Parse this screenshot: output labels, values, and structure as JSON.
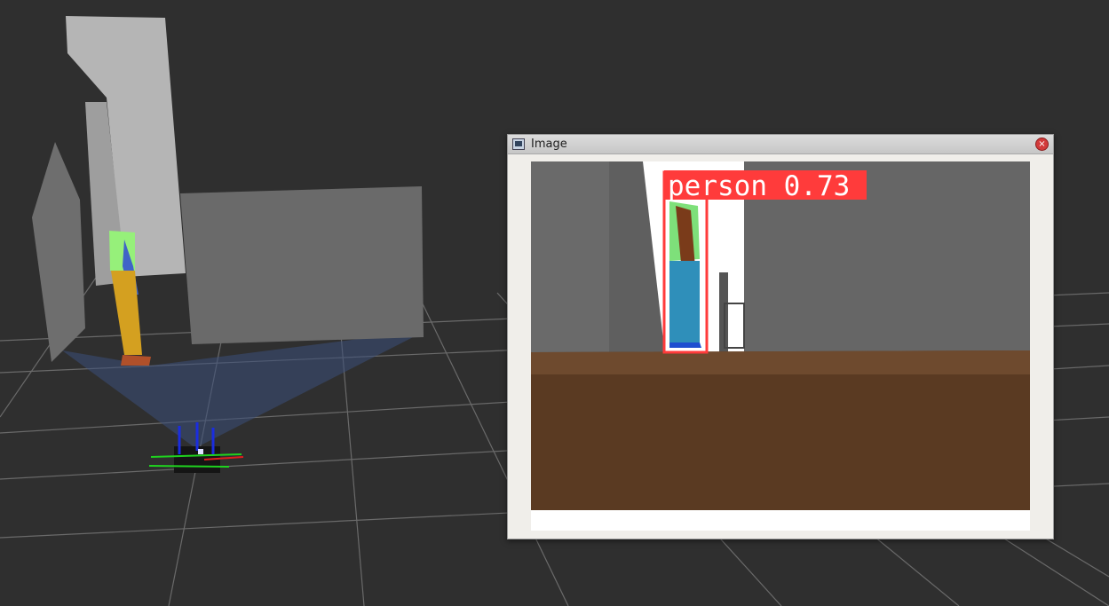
{
  "window": {
    "title": "Image",
    "close_glyph": "×",
    "icon": "image-window-icon",
    "close_icon": "close-icon"
  },
  "detection": {
    "label": "person 0.73",
    "class": "person",
    "confidence": 0.73,
    "box_color": "#ff3b3b"
  },
  "colors": {
    "viewport_bg": "#2f2f2f",
    "grid": "#6e6e6e",
    "floor_brown": "#5a3a22",
    "wall_gray": "#666666"
  }
}
